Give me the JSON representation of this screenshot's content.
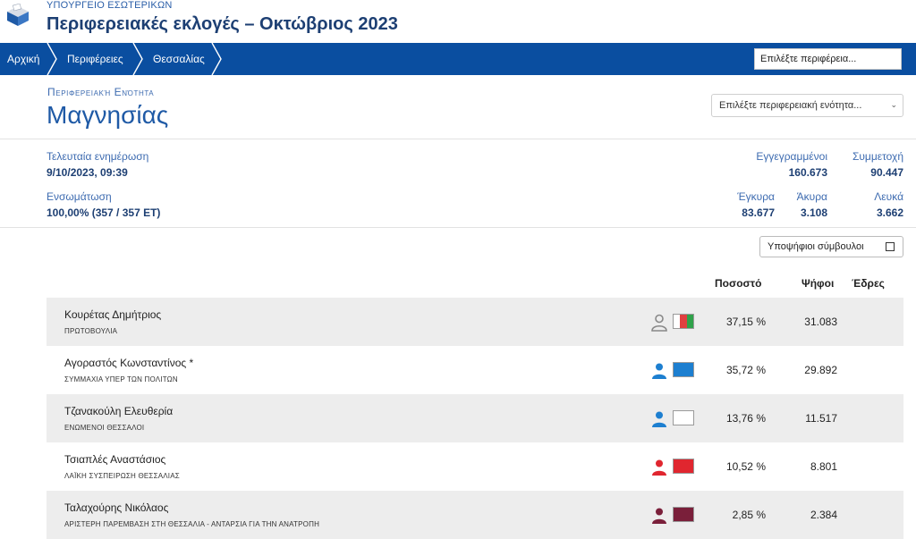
{
  "header": {
    "ministry": "ΥΠΟΥΡΓΕΙΟ ΕΣΩΤΕΡΙΚΩΝ",
    "title": "Περιφερειακές εκλογές – Οκτώβριος 2023",
    "logo_icon": "ballot-box-icon"
  },
  "breadcrumbs": [
    "Αρχική",
    "Περιφέρειες",
    "Θεσσαλίας"
  ],
  "region_select": {
    "placeholder": "Επιλέξτε περιφέρεια..."
  },
  "unit": {
    "label": "Περιφερειακή Ενότητα",
    "name": "Μαγνησίας",
    "select_placeholder": "Επιλέξτε περιφερειακή ενότητα...",
    "select_icon": "chevron-down-icon"
  },
  "stats": {
    "last_update_label": "Τελευταία ενημέρωση",
    "last_update_value": "9/10/2023, 09:39",
    "integration_label": "Ενσωμάτωση",
    "integration_value": "100,00% (357 / 357 ΕΤ)",
    "registered_label": "Εγγεγραμμένοι",
    "registered_value": "160.673",
    "turnout_label": "Συμμετοχή",
    "turnout_value": "90.447",
    "valid_label": "Έγκυρα",
    "valid_value": "83.677",
    "invalid_label": "Άκυρα",
    "invalid_value": "3.108",
    "blank_label": "Λευκά",
    "blank_value": "3.662"
  },
  "toggle_candidates": {
    "label": "Υποψήφιοι σύμβουλοι"
  },
  "columns": {
    "percent": "Ποσοστό",
    "votes": "Ψήφοι",
    "seats": "Έδρες"
  },
  "results": [
    {
      "name": "Κουρέτας Δημήτριος",
      "party": "ΠΡΩΤΟΒΟΥΛΙΑ",
      "percent": "37,15 %",
      "votes": "31.083",
      "person_color": "#888888",
      "person_style": "outline",
      "swatch": [
        "#ffffff",
        "#e04040",
        "#2fa24a"
      ]
    },
    {
      "name": "Αγοραστός Κωνσταντίνος *",
      "party": "ΣΥΜΜΑΧΙΑ ΥΠΕΡ ΤΩΝ ΠΟΛΙΤΩΝ",
      "percent": "35,72 %",
      "votes": "29.892",
      "person_color": "#1d7fd0",
      "person_style": "solid",
      "swatch": [
        "#1d7fd0"
      ]
    },
    {
      "name": "Τζανακούλη Ελευθερία",
      "party": "ΕΝΩΜΕΝΟΙ ΘΕΣΣΑΛΟΙ",
      "percent": "13,76 %",
      "votes": "11.517",
      "person_color": "#1d7fd0",
      "person_style": "solid",
      "swatch": [
        "#ffffff"
      ]
    },
    {
      "name": "Τσιαπλές Αναστάσιος",
      "party": "ΛΑΪΚΗ ΣΥΣΠΕΙΡΩΣΗ ΘΕΣΣΑΛΙΑΣ",
      "percent": "10,52 %",
      "votes": "8.801",
      "person_color": "#e0262f",
      "person_style": "solid",
      "swatch": [
        "#e0262f"
      ]
    },
    {
      "name": "Ταλαχούρης Νικόλαος",
      "party": "ΑΡΙΣΤΕΡΗ ΠΑΡΕΜΒΑΣΗ ΣΤΗ ΘΕΣΣΑΛΙΑ - ΑΝΤΑΡΣΙΑ ΓΙΑ ΤΗΝ ΑΝΑΤΡΟΠΗ",
      "percent": "2,85 %",
      "votes": "2.384",
      "person_color": "#7a1f3a",
      "person_style": "solid",
      "swatch": [
        "#7a1f3a"
      ]
    }
  ]
}
